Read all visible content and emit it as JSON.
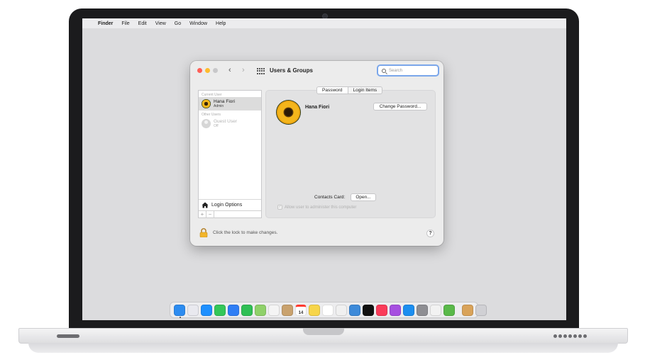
{
  "menubar": {
    "apple_glyph": "",
    "app_name": "Finder",
    "items": [
      "File",
      "Edit",
      "View",
      "Go",
      "Window",
      "Help"
    ]
  },
  "window": {
    "title": "Users & Groups",
    "search_placeholder": "Search",
    "sidebar": {
      "current_header": "Current User",
      "current_user": {
        "name": "Hana Fiori",
        "role": "Admin"
      },
      "other_header": "Other Users",
      "guest_user": {
        "name": "Guest User",
        "status": "Off"
      },
      "login_options_label": "Login Options",
      "add_label": "+",
      "remove_label": "−"
    },
    "tabs": [
      "Password",
      "Login Items"
    ],
    "user_full_name": "Hana Fiori",
    "change_password_label": "Change Password...",
    "contacts_card_label": "Contacts Card:",
    "open_label": "Open...",
    "allow_admin_label": "Allow user to administer this computer",
    "lock_text": "Click the lock to make changes.",
    "help_label": "?"
  },
  "dock": {
    "icons": [
      {
        "name": "finder-icon",
        "color": "#2d8cf0"
      },
      {
        "name": "launchpad-icon",
        "color": "#e9e9ef"
      },
      {
        "name": "safari-icon",
        "color": "#1e90ff"
      },
      {
        "name": "messages-icon",
        "color": "#34c759"
      },
      {
        "name": "mail-icon",
        "color": "#2f7ef5"
      },
      {
        "name": "facetime-icon",
        "color": "#2fbf55"
      },
      {
        "name": "maps-icon",
        "color": "#8fd16a"
      },
      {
        "name": "photos-icon",
        "color": "#f4f4f4"
      },
      {
        "name": "contacts-icon",
        "color": "#c9a26e"
      },
      {
        "name": "calendar-icon",
        "color": "#ffffff",
        "text": "14"
      },
      {
        "name": "notes-icon",
        "color": "#f7d54a"
      },
      {
        "name": "reminders-icon",
        "color": "#ffffff"
      },
      {
        "name": "freeform-icon",
        "color": "#f0f0f0"
      },
      {
        "name": "stickies-icon",
        "color": "#3d8ad9"
      },
      {
        "name": "tv-icon",
        "color": "#111111"
      },
      {
        "name": "music-icon",
        "color": "#fa3c5a"
      },
      {
        "name": "podcasts-icon",
        "color": "#a64fe0"
      },
      {
        "name": "app-store-icon",
        "color": "#1c8ef0"
      },
      {
        "name": "system-settings-icon",
        "color": "#8e8e93"
      },
      {
        "name": "game-center-icon",
        "color": "#f2f2f2"
      },
      {
        "name": "keychain-icon",
        "color": "#5ab94a"
      },
      {
        "name": "archive-utility-icon",
        "color": "#d9a35a"
      },
      {
        "name": "trash-icon",
        "color": "#d0d0d4"
      }
    ]
  }
}
